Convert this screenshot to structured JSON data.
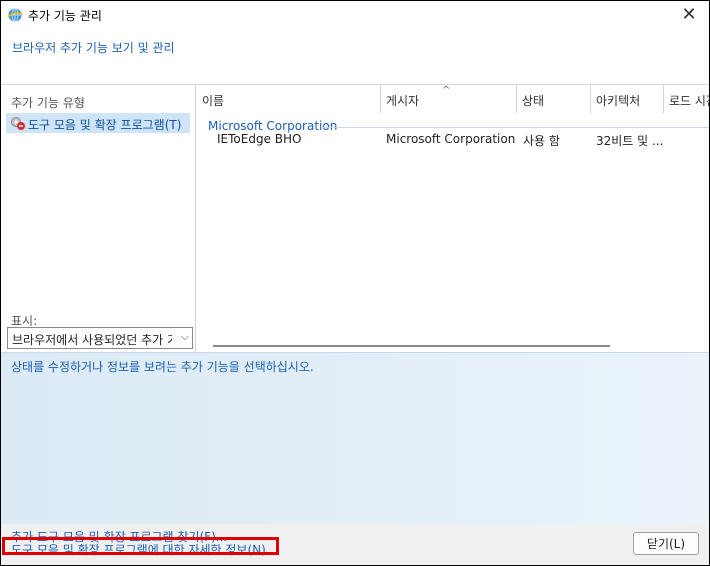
{
  "window": {
    "title": "추가 기능 관리",
    "subtitle": "브라우저 추가 기능 보기 및 관리"
  },
  "sidebar": {
    "title": "추가 기능 유형",
    "items": [
      {
        "label": "도구 모음 및 확장 프로그램(T)",
        "icon": "toolbar-extension-icon"
      }
    ],
    "show_label": "표시:",
    "show_value": "브라우저에서 사용되었던 추가 기능"
  },
  "list": {
    "columns": [
      "이름",
      "게시자",
      "상태",
      "아키텍처",
      "로드 시간"
    ],
    "groups": [
      {
        "name": "Microsoft Corporation",
        "rows": [
          {
            "name": "IEToEdge BHO",
            "publisher": "Microsoft Corporation",
            "status": "사용 함",
            "architecture": "32비트 및 ..."
          }
        ]
      }
    ]
  },
  "details": {
    "message": "상태를 수정하거나 정보를 보려는 추가 기능을 선택하십시오."
  },
  "footer": {
    "find_link": "추가 도구 모음 및 확장 프로그램 찾기(F)...",
    "learn_link": "도구 모음 및 확장 프로그램에 대한 자세한 정보(N)",
    "close_button": "닫기(L)"
  },
  "colors": {
    "link": "#1a5fb4",
    "selection": "#cfe5f7",
    "highlight_box": "#e00000"
  }
}
